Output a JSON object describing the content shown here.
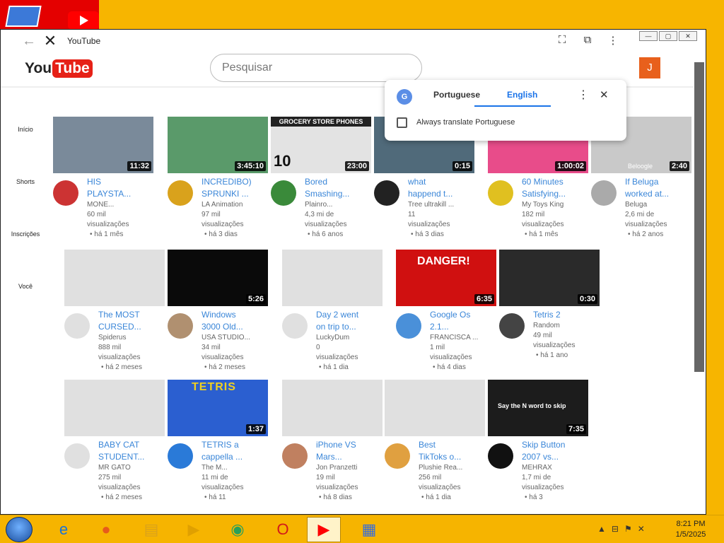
{
  "window": {
    "title": "YouTube",
    "tools": [
      "translate-icon",
      "extensions-icon",
      "more-icon"
    ],
    "win_buttons": [
      "minimize",
      "maximize",
      "close"
    ]
  },
  "youtube": {
    "logo_you": "You",
    "logo_tube": "Tube",
    "search_placeholder": "Pesquisar",
    "avatar_letter": "J"
  },
  "sidebar": {
    "items": [
      {
        "label": "Início"
      },
      {
        "label": "Shorts"
      },
      {
        "label": "Inscrições"
      },
      {
        "label": "Você"
      }
    ]
  },
  "translate": {
    "source": "Portuguese",
    "target": "English",
    "always_label": "Always translate Portuguese",
    "more_label": "⋮",
    "close_label": "✕"
  },
  "videos": [
    {
      "title1": "HIS",
      "title2": "PLAYSTA...",
      "channel": "MONE...",
      "views1": "60 mil",
      "views2": "visualizações",
      "age": "há 1 mês",
      "duration": "11:32",
      "thumb_color": "#7a8a9a"
    },
    {
      "title1": "INCREDIBO)",
      "title2": "SPRUNKI ...",
      "channel": "LA Animation",
      "views1": "97 mil",
      "views2": "visualizações",
      "age": "há 3 dias",
      "duration": "3:45:10",
      "thumb_color": "#5a9a6a"
    },
    {
      "title1": "Bored",
      "title2": "Smashing...",
      "channel": "Plainro...",
      "views1": "4,3 mi de",
      "views2": "visualizações",
      "age": "há 6 anos",
      "duration": "23:00",
      "thumb_color": "#e3e3e3"
    },
    {
      "title1": "what",
      "title2": "happend t...",
      "channel": "Tree ultrakill ...",
      "views1": "11",
      "views2": "visualizações",
      "age": "há 3 dias",
      "duration": "0:15",
      "thumb_color": "#506a7a"
    },
    {
      "title1": "60 Minutes",
      "title2": "Satisfying...",
      "channel": "My Toys King",
      "views1": "182 mil",
      "views2": "visualizações",
      "age": "há 1 mês",
      "duration": "1:00:02",
      "thumb_color": "#e84c8a"
    },
    {
      "title1": "If Beluga",
      "title2": "worked at...",
      "channel": "Beluga",
      "views1": "2,6 mi de",
      "views2": "visualizações",
      "age": "há 2 anos",
      "duration": "2:40",
      "thumb_color": "#c9c9c9"
    },
    {
      "title1": "The MOST",
      "title2": "CURSED...",
      "channel": "Spiderus",
      "views1": "888 mil",
      "views2": "visualizações",
      "age": "há 2 meses",
      "duration": "",
      "thumb_color": "#e0e0e0"
    },
    {
      "title1": "Windows",
      "title2": "3000 Old...",
      "channel": "USA STUDIO...",
      "views1": "34 mil",
      "views2": "visualizações",
      "age": "há 2 meses",
      "duration": "5:26",
      "thumb_color": "#0a0a0a"
    },
    {
      "title1": "Day 2 went",
      "title2": "on trip to...",
      "channel": "LuckyDum",
      "views1": "0",
      "views2": "visualizações",
      "age": "há 1 dia",
      "duration": "",
      "thumb_color": "#e0e0e0"
    },
    {
      "title1": "Google Os",
      "title2": "2.1...",
      "channel": "FRANCISCA ...",
      "views1": "1 mil",
      "views2": "visualizações",
      "age": "há 4 dias",
      "duration": "6:35",
      "thumb_color": "#d01010"
    },
    {
      "title1": "Tetris 2",
      "title2": "",
      "channel": "Random",
      "views1": "49 mil",
      "views2": "visualizações",
      "age": "há 1 ano",
      "duration": "0:30",
      "thumb_color": "#2a2a2a"
    },
    {
      "title1": "BABY CAT",
      "title2": "STUDENT...",
      "channel": "MR GATO",
      "views1": "275 mil",
      "views2": "visualizações",
      "age": "há 2 meses",
      "duration": "",
      "thumb_color": "#e0e0e0"
    },
    {
      "title1": "TETRIS a",
      "title2": "cappella ...",
      "channel": "The M...",
      "views1": "11 mi de",
      "views2": "visualizações",
      "age": "há 11",
      "duration": "1:37",
      "thumb_color": "#2b5fd0"
    },
    {
      "title1": "iPhone VS",
      "title2": "Mars...",
      "channel": "Jon Pranzetti",
      "views1": "19 mil",
      "views2": "visualizações",
      "age": "há 8 dias",
      "duration": "",
      "thumb_color": "#e0e0e0"
    },
    {
      "title1": "Best",
      "title2": "TikToks o...",
      "channel": "Plushie Rea...",
      "views1": "256 mil",
      "views2": "visualizações",
      "age": "há 1 dia",
      "duration": "",
      "thumb_color": "#e0e0e0"
    },
    {
      "title1": "Skip Button",
      "title2": "2007 vs...",
      "channel": "MEHRAX",
      "views1": "1,7 mi de",
      "views2": "visualizações",
      "age": "há 3",
      "duration": "7:35",
      "thumb_color": "#1c1c1c"
    }
  ],
  "thumb_text": {
    "grocery": "GROCERY STORE PHONES",
    "grocery_num": "10",
    "danger": "DANGER!",
    "tetris": "TETRIS",
    "skip": "Say the N word to skip",
    "beloogle": "Beloogle"
  },
  "taskbar": {
    "time": "8:21 PM",
    "date": "1/5/2025",
    "apps": [
      "ie-icon",
      "firefox-icon",
      "explorer-icon",
      "media-icon",
      "app-icon",
      "opera-icon",
      "youtube-icon",
      "control-panel-icon"
    ]
  }
}
